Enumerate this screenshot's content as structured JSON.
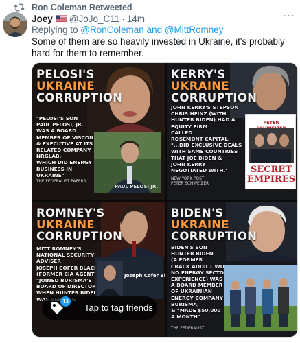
{
  "retweet": {
    "label": "Ron Coleman Retweeted",
    "icon": "retweet-icon"
  },
  "tweet": {
    "author_name": "Joey",
    "flag": "us-flag",
    "handle": "@JoJo_C11",
    "separator": "·",
    "time": "14m",
    "replying_prefix": "Replying to ",
    "reply_to_1": "@RonColeman",
    "reply_join": " and ",
    "reply_to_2": "@MittRomney",
    "text": "Some of them are so heavily invested in Ukraine, it's probably hard for them to remember.",
    "more_label": "···"
  },
  "media": {
    "panels": [
      {
        "title_line1": "PELOSI'S",
        "title_line2": "UKRAINE",
        "title_line3": "CORRUPTION",
        "body": [
          "\"PELOSI'S SON",
          "PAUL PELOSI, JR.",
          "WAS A BOARD",
          "MEMBER OF VISCOIL",
          "& EXECUTIVE AT ITS",
          "RELATED COMPANY",
          "NRGLAB,",
          "WHICH DID ENERGY",
          "BUSINESS IN",
          "UKRAINE\""
        ],
        "source": "THE FEDERALIST PAPERS",
        "photo_caption": "PAUL PELOSI JR."
      },
      {
        "title_line1": "KERRY'S",
        "title_line2": "UKRAINE",
        "title_line3": "CORRUPTION",
        "body": [
          "JOHN KERRY'S STEPSON",
          "CHRIS HEINZ (WITH",
          "HUNTER BIDEN) HAD A",
          "EQUITY FIRM",
          "CALLED",
          "ROSEMONT CAPITAL,",
          "\"...DID EXCLUSIVE DEALS",
          "WITH SAME COUNTRIES",
          "THAT JOE BIDEN &",
          "JOHN KERRY",
          "NEGOTIATED WITH.'"
        ],
        "source_1": "NEW YORK POST",
        "source_2": "PETER SCHWEIZER",
        "book_author": "PETER SCHWEIZER",
        "book_title_1": "SECRET",
        "book_title_2": "EMPIRES"
      },
      {
        "title_line1": "ROMNEY'S",
        "title_line2": "UKRAINE",
        "title_line3": "CORRUPTION",
        "body": [
          "MITT ROMNEY'S",
          "NATIONAL SECURITY",
          "ADVISER",
          "JOSEPH COFER BLACK",
          "(FORMER CIA AGENT)",
          "\"JOINED BURISMA'S",
          "BOARD OF DIRECTORS",
          "WHEN HUNTER BIDEN",
          "WAS SERVING"
        ],
        "photo_caption": "Joseph Cofer Black"
      },
      {
        "title_line1": "BIDEN'S",
        "title_line2": "UKRAINE",
        "title_line3": "CORRUPTION",
        "body": [
          "BIDEN'S SON",
          "HUNTER BIDEN",
          "(A FORMER",
          "CRACK ADDICT WITH",
          "NO ENERGY SECTOR",
          "EXPERIENCE) WAS",
          "A BOARD MEMBER",
          "OF UKRAINIAN",
          "ENERGY COMPANY",
          "BURISMA,",
          "& \"MADE $50,000",
          "A MONTH\""
        ],
        "source": "THE FEDERALIST"
      }
    ],
    "tag_overlay": {
      "count": "13",
      "label": "Tap to tag friends",
      "icon": "tag-icon"
    }
  },
  "colors": {
    "accent": "#1d9bf0",
    "muted": "#536471",
    "highlight": "#ff9a3d"
  }
}
